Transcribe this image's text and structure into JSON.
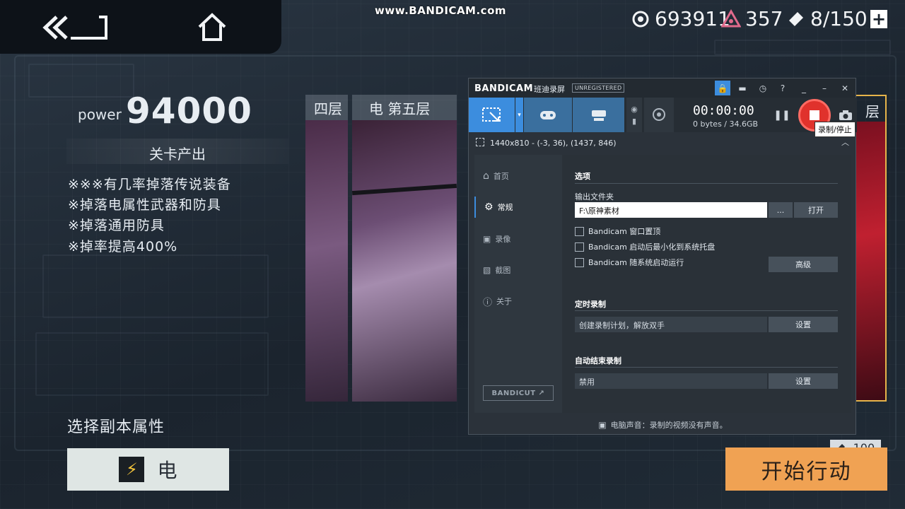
{
  "watermark": "www.BANDICAM.com",
  "resources": {
    "gold": "693911",
    "energy": "357",
    "tickets": "8/150",
    "plus": "+"
  },
  "stage": {
    "power_label": "power",
    "power_value": "94000",
    "section_title": "关卡产出",
    "drops": [
      "※※※有几率掉落传说装备",
      "※掉落电属性武器和防具",
      "※掉落通用防具",
      "※掉率提高400%"
    ],
    "choose_label": "选择副本属性",
    "element_label": "电",
    "start_label": "开始行动",
    "cost": "-100",
    "columns": [
      {
        "title": "四层"
      },
      {
        "title": "电 第五层"
      }
    ],
    "right_col_fragment": "层"
  },
  "bandicam": {
    "logo": "BANDICAM",
    "title_cn": "班迪录屏",
    "unregistered": "UNREGISTERED",
    "help": "?",
    "timer": "00:00:00",
    "bytes": "0 bytes / 34.6GB",
    "tooltip": "录制/停止",
    "region_info": "1440x810 - (-3, 36), (1437, 846)",
    "sidebar": [
      "首页",
      "常规",
      "录像",
      "截图",
      "关于"
    ],
    "bandicut": "BANDICUT ↗",
    "options_title": "选项",
    "output_folder_label": "输出文件夹",
    "output_path": "F:\\原神素材",
    "browse_label": "...",
    "open_label": "打开",
    "checkboxes": [
      "Bandicam 窗口置顶",
      "Bandicam 启动后最小化到系统托盘",
      "Bandicam 随系统启动运行"
    ],
    "advanced_label": "高级",
    "schedule_title": "定时录制",
    "schedule_text": "创建录制计划，解放双手",
    "settings_label": "设置",
    "autostop_title": "自动结束录制",
    "autostop_text": "禁用",
    "footer": "电脑声音：录制的视频没有声音。"
  },
  "colors": {
    "accent": "#3c8dde",
    "record": "#e0322c",
    "start_button": "#f0a253",
    "highlight_border": "#e6b44a"
  }
}
